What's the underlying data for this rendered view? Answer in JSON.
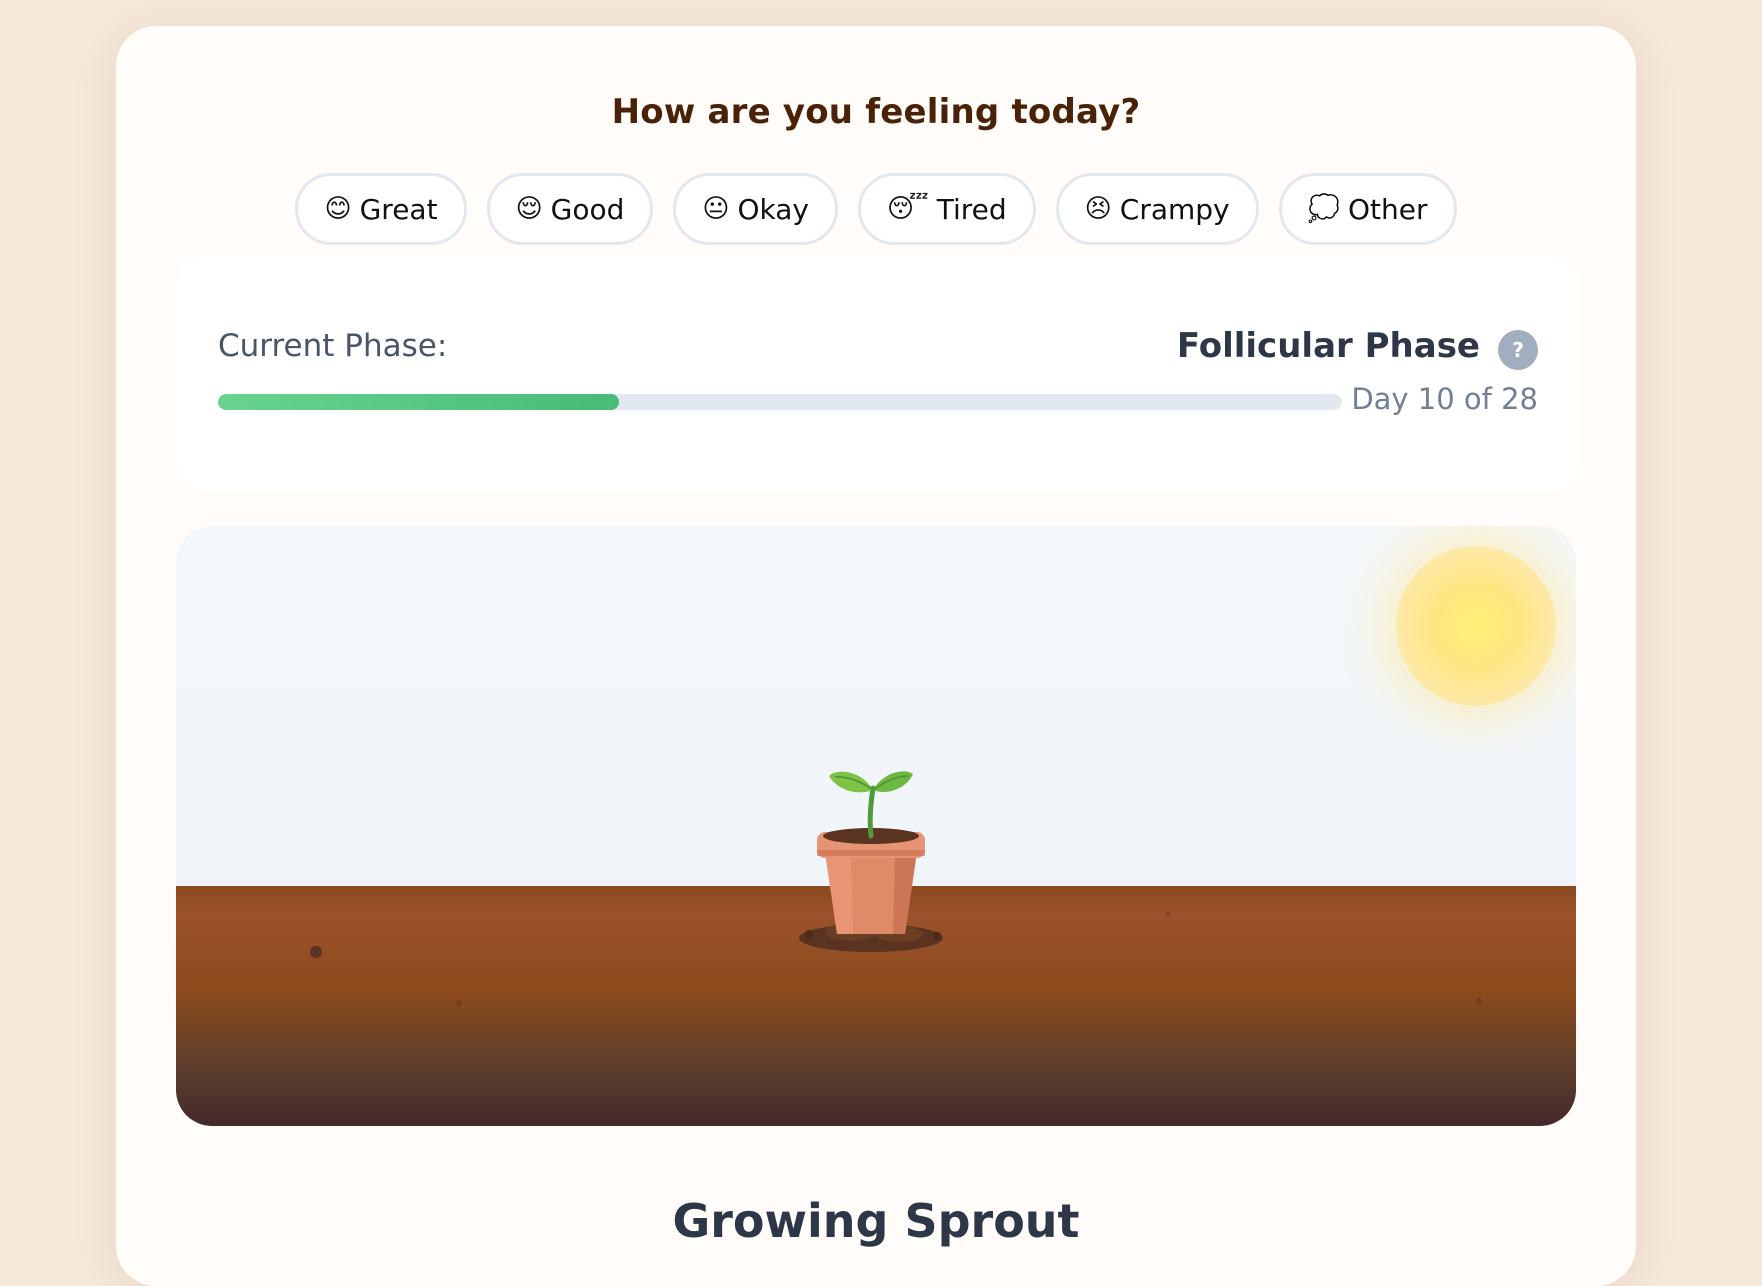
{
  "question": "How are you feeling today?",
  "moods": [
    {
      "emoji": "😊",
      "label": "Great"
    },
    {
      "emoji": "😌",
      "label": "Good"
    },
    {
      "emoji": "😐",
      "label": "Okay"
    },
    {
      "emoji": "😴",
      "label": "Tired"
    },
    {
      "emoji": "😣",
      "label": "Crampy"
    },
    {
      "emoji": "💭",
      "label": "Other"
    }
  ],
  "phase": {
    "label": "Current Phase:",
    "name": "Follicular Phase",
    "help_icon": "?",
    "day_text": "Day 10 of 28",
    "progress_fraction": 0.357,
    "progress_color": "#48bb78"
  },
  "scene": {
    "sun_icon": "sun-icon",
    "plant_icon": "potted-sprout-icon"
  },
  "stage_title": "Growing Sprout"
}
